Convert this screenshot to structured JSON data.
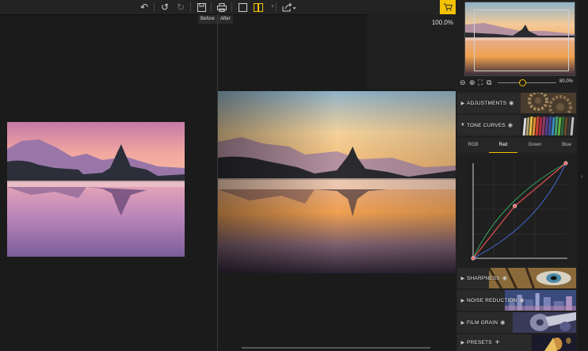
{
  "toolbar": {
    "icons": [
      "undo-history-icon",
      "undo-icon",
      "redo-icon",
      "save-icon",
      "print-icon",
      "single-view-icon",
      "split-view-icon",
      "share-icon",
      "cart-icon"
    ],
    "before_label": "Before",
    "after_label": "After",
    "cart_color": "#f2c100"
  },
  "canvas": {
    "zoom_readout": "100.0%"
  },
  "navigator": {
    "zoom_value": "80.0%",
    "zoom_slider_fraction": 0.42
  },
  "sections": [
    {
      "label": "ADJUSTMENTS",
      "expanded": false
    },
    {
      "label": "TONE CURVES",
      "expanded": true
    },
    {
      "label": "SHARPNESS",
      "expanded": false
    },
    {
      "label": "NOISE REDUCTION",
      "expanded": false
    },
    {
      "label": "FILM GRAIN",
      "expanded": false
    },
    {
      "label": "PRESETS",
      "expanded": false
    }
  ],
  "tone_curve": {
    "tabs": [
      "RGB",
      "Red",
      "Green",
      "Blue"
    ],
    "active_tab": "Red",
    "colors": {
      "red": "#e05050",
      "green": "#3aa860",
      "blue": "#4466cc"
    },
    "red_points": [
      [
        0.0,
        0.0
      ],
      [
        0.45,
        0.55
      ],
      [
        1.0,
        1.0
      ]
    ]
  }
}
